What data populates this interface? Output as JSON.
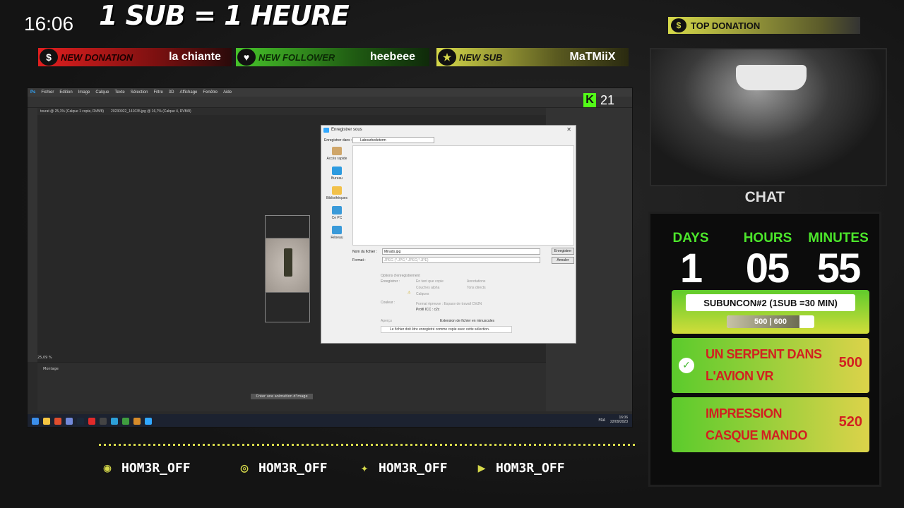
{
  "overlay": {
    "clock": "16:06",
    "title": "1 SUB = 1 HEURE",
    "alerts": [
      {
        "label": "NEW DONATION",
        "value": "la chiante",
        "icon": "dollar-icon"
      },
      {
        "label": "NEW FOLLOWER",
        "value": "heebeee",
        "icon": "heart-icon"
      },
      {
        "label": "NEW SUB",
        "value": "MaTMiiX",
        "icon": "star-icon"
      }
    ],
    "top_donation_label": "TOP DONATION",
    "chat_label": "CHAT",
    "kick_viewers": "21",
    "colors": {
      "accent": "#d6d94a",
      "green": "#4ce62b",
      "red": "#d22020"
    }
  },
  "subathon": {
    "days_label": "DAYS",
    "hours_label": "HOURS",
    "minutes_label": "MINUTES",
    "days": "1",
    "hours": "05",
    "minutes": "55",
    "goal_title": "SUBUNCON#2 (1SUB =30 MIN)",
    "goal_progress_text": "500 | 600",
    "goal_current": 500,
    "goal_target": 600,
    "goals": [
      {
        "name": "UN SERPENT DANS L'AVION VR",
        "points": "500",
        "done": true
      },
      {
        "name": "IMPRESSION CASQUE MANDO",
        "points": "520",
        "done": false
      }
    ]
  },
  "socials": [
    {
      "icon": "discord-icon",
      "handle": "HOM3R_OFF"
    },
    {
      "icon": "instagram-icon",
      "handle": "HOM3R_OFF"
    },
    {
      "icon": "twitter-icon",
      "handle": "HOM3R_OFF"
    },
    {
      "icon": "youtube-icon",
      "handle": "HOM3R_OFF"
    }
  ],
  "photoshop": {
    "menu": [
      "Fichier",
      "Edition",
      "Image",
      "Calque",
      "Texte",
      "Sélection",
      "Filtre",
      "3D",
      "Affichage",
      "Fenêtre",
      "Aide"
    ],
    "tabs": [
      "tourat @ 25,1% (Calque 1 copie, RVB/8)",
      "20230922_141035.jpg @ 16,7% (Calque 4, RVB/8)"
    ],
    "zoom": "25,09 %",
    "timeline_label": "Montage",
    "create_animation": "Créer une animation d'image",
    "taskbar_time": "16:06",
    "taskbar_date": "22/09/2023",
    "taskbar_lang": "FRA"
  },
  "save_dialog": {
    "title": "Enregistrer sous",
    "save_in_label": "Enregistrer dans :",
    "save_in_value": "Labourbedeterm",
    "sidebar": [
      "Accès rapide",
      "Bureau",
      "Bibliothèques",
      "Ce PC",
      "Réseau"
    ],
    "filename_label": "Nom du fichier :",
    "filename_value": "Mirado.jpg",
    "format_label": "Format :",
    "format_value": "JPEG (*.JPG;*.JPEG;*.JPE)",
    "save_button": "Enregistrer",
    "cancel_button": "Annuler",
    "options_title": "Options d'enregistrement",
    "save_label": "Enregistrer :",
    "options": [
      "En tant que copie",
      "Annotations",
      "Couches alpha",
      "Tons directs",
      "Calques"
    ],
    "color_label": "Couleur :",
    "color_options": [
      "Format épreuve : Espace de travail CMJN",
      "Profil ICC : c2c"
    ],
    "preview_label": "Aperçu",
    "extension_label": "Extension de fichier en minuscules",
    "warning": "Le fichier doit être enregistré comme copie avec cette sélection."
  }
}
